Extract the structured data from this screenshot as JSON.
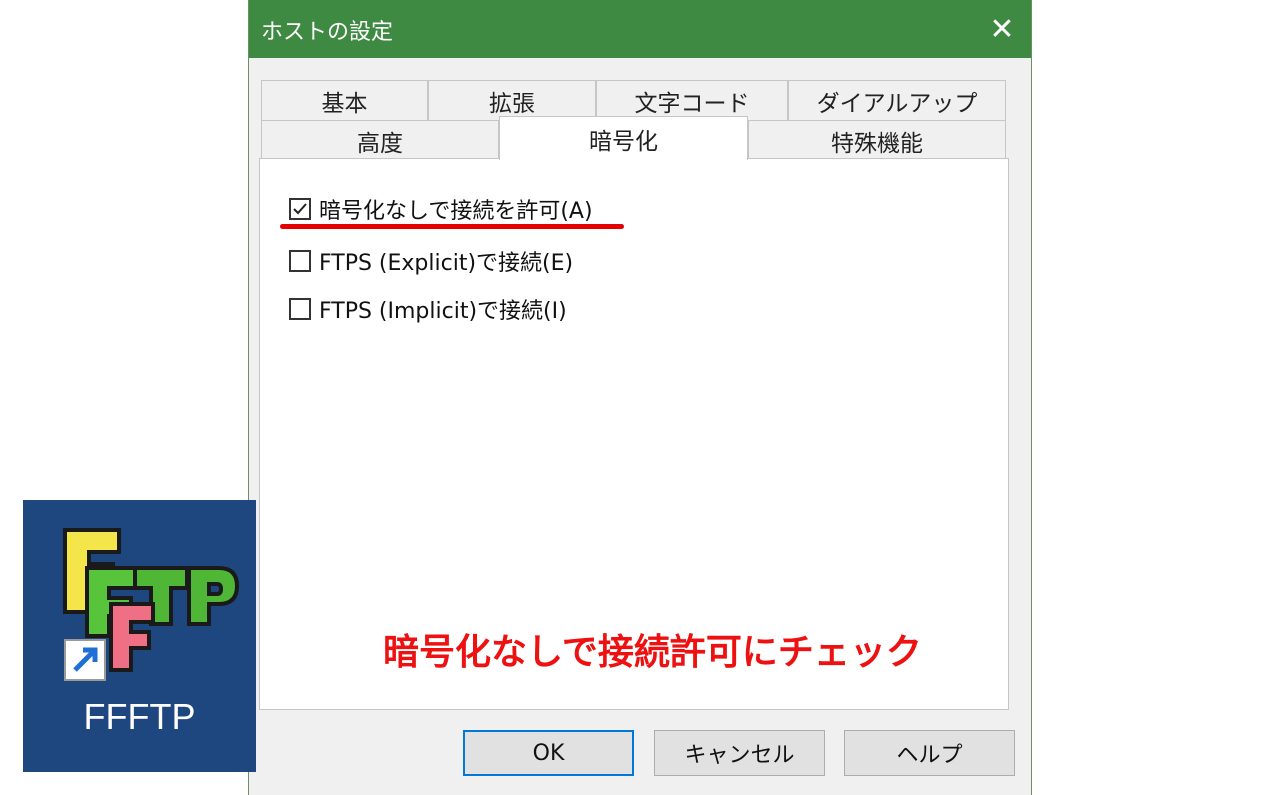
{
  "dialog": {
    "title": "ホストの設定",
    "close_glyph": "✕",
    "tabs_row1": [
      "基本",
      "拡張",
      "文字コード",
      "ダイアルアップ"
    ],
    "tabs_row2": [
      "高度",
      "暗号化",
      "特殊機能"
    ],
    "active_tab": "暗号化",
    "options": [
      {
        "label": "暗号化なしで接続を許可(A)",
        "checked": true
      },
      {
        "label": "FTPS (Explicit)で接続(E)",
        "checked": false
      },
      {
        "label": "FTPS (Implicit)で接続(I)",
        "checked": false
      }
    ],
    "annotation": "暗号化なしで接続許可にチェック",
    "buttons": {
      "ok": "OK",
      "cancel": "キャンセル",
      "help": "ヘルプ"
    }
  },
  "app_icon": {
    "label": "FFFTP",
    "logo_text": "FFFTP",
    "icon": "ffftp-shortcut-icon"
  },
  "colors": {
    "titlebar": "#3f8a43",
    "annotation": "#ee1111",
    "icon_bg": "#1f477f"
  }
}
